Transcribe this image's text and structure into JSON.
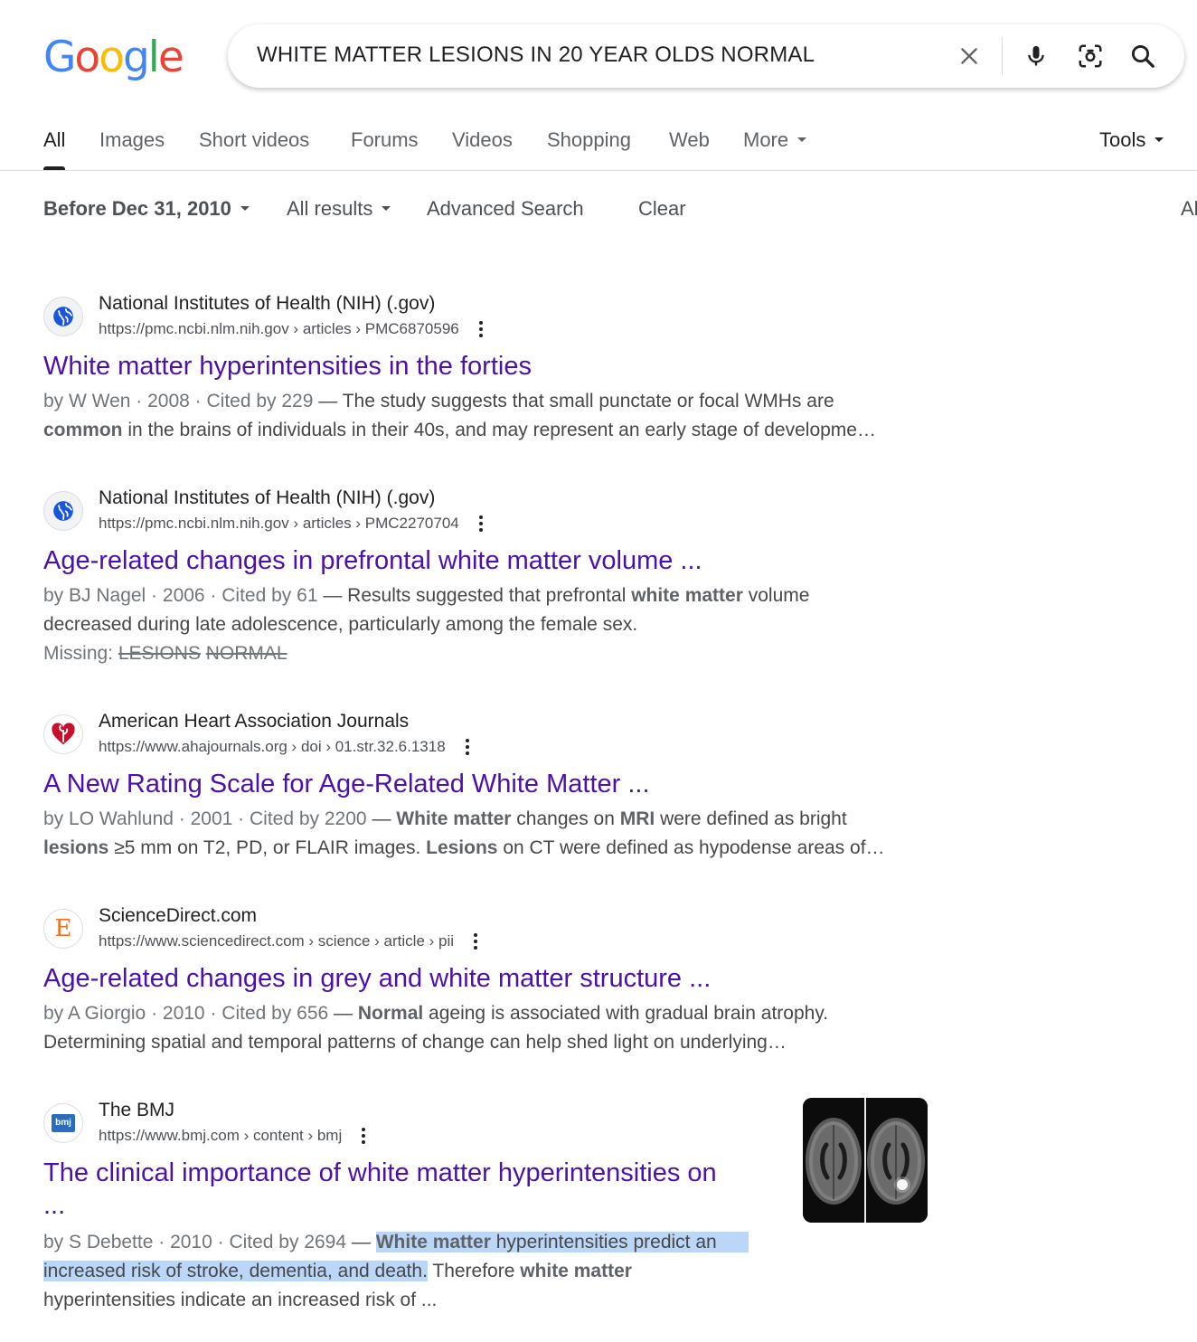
{
  "logo": {
    "letters": [
      "G",
      "o",
      "o",
      "g",
      "l",
      "e"
    ],
    "colors": [
      "#4285F4",
      "#EA4335",
      "#FBBC05",
      "#4285F4",
      "#34A853",
      "#EA4335"
    ]
  },
  "search": {
    "query": "WHITE MATTER LESIONS IN 20 YEAR OLDS NORMAL"
  },
  "tabs": [
    {
      "label": "All",
      "active": true
    },
    {
      "label": "Images"
    },
    {
      "label": "Short videos"
    },
    {
      "label": "Forums"
    },
    {
      "label": "Videos"
    },
    {
      "label": "Shopping"
    },
    {
      "label": "Web"
    },
    {
      "label": "More"
    }
  ],
  "tools_label": "Tools",
  "filters": {
    "date": "Before Dec 31, 2010",
    "results": "All results",
    "advanced": "Advanced Search",
    "clear": "Clear",
    "cut": "Al"
  },
  "results": [
    {
      "site": "National Institutes of Health (NIH) (.gov)",
      "url": "https://pmc.ncbi.nlm.nih.gov › articles › PMC6870596",
      "title": "White matter hyperintensities in the forties",
      "meta": "by W Wen · 2008 · Cited by 229",
      "snippet_a": "The study suggests that small punctate or focal WMHs are",
      "snippet_b1": "common",
      "snippet_b2": " in the brains of individuals in their 40s, and may represent an early stage of developme…"
    },
    {
      "site": "National Institutes of Health (NIH) (.gov)",
      "url": "https://pmc.ncbi.nlm.nih.gov › articles › PMC2270704",
      "title": "Age-related changes in prefrontal white matter volume ...",
      "meta": "by BJ Nagel · 2006 · Cited by 61",
      "snippet_a1": "Results suggested that prefrontal ",
      "snippet_a2": "white matter",
      "snippet_a3": " volume",
      "snippet_b": "decreased during late adolescence, particularly among the female sex.",
      "missing_label": "Missing: ",
      "missing_1": "LESIONS",
      "missing_2": "NORMAL"
    },
    {
      "site": "American Heart Association Journals",
      "url": "https://www.ahajournals.org › doi › 01.str.32.6.1318",
      "title": "A New Rating Scale for Age-Related White Matter ...",
      "meta": "by LO Wahlund · 2001 · Cited by 2200",
      "s1": "White matter",
      "s2": " changes on ",
      "s3": "MRI",
      "s4": " were defined as bright",
      "s5": "lesions",
      "s6": " ≥5 mm on T2, PD, or FLAIR images. ",
      "s7": "Lesions",
      "s8": " on CT were defined as hypodense areas of…"
    },
    {
      "site": "ScienceDirect.com",
      "url": "https://www.sciencedirect.com › science › article › pii",
      "title": "Age-related changes in grey and white matter structure ...",
      "meta": "by A Giorgio · 2010 · Cited by 656",
      "s1": "Normal",
      "s2": " ageing is associated with gradual brain atrophy.",
      "s3": "Determining spatial and temporal patterns of change can help shed light on underlying…",
      "favicon_letter": "E"
    },
    {
      "site": "The BMJ",
      "url": "https://www.bmj.com › content › bmj",
      "title_1": "The clinical importance of white matter hyperintensities on",
      "title_2": "...",
      "meta": "by S Debette · 2010 · Cited by 2694",
      "s1": "White matter",
      "s2": " hyperintensities predict an",
      "s3": "increased risk of stroke, dementia, and death.",
      "s4": " Therefore ",
      "s5": "white matter",
      "s6": "hyperintensities indicate an increased risk of ...",
      "favicon_text": "bmj"
    }
  ]
}
